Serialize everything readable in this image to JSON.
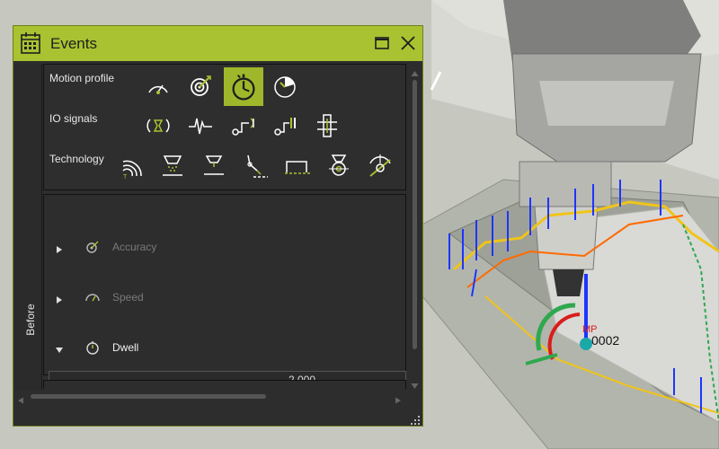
{
  "panel": {
    "title": "Events",
    "side_tab": "Before"
  },
  "categories": [
    {
      "label": "Motion profile",
      "icons": [
        "accuracy-gauge-icon",
        "accuracy-target-icon",
        "dwell-stopwatch-icon",
        "speed-dial-icon"
      ],
      "selected": "dwell-stopwatch-icon"
    },
    {
      "label": "IO signals",
      "icons": [
        "io-pulse-icon",
        "io-waveform-icon",
        "io-output-signal-icon",
        "io-wait-signal-icon",
        "io-clamp-icon"
      ]
    },
    {
      "label": "Technology",
      "icons": [
        "tech-radiation-icon",
        "tech-spray-icon",
        "tech-dispense-icon",
        "tech-robot-arm-icon",
        "tech-path-segment-icon",
        "tech-spindle-icon",
        "tech-sensor-icon"
      ]
    }
  ],
  "events": [
    {
      "label": "Accuracy",
      "expanded": false,
      "enabled": false
    },
    {
      "label": "Speed",
      "expanded": false,
      "enabled": false
    },
    {
      "label": "Dwell",
      "expanded": true,
      "enabled": true,
      "value": "2.000"
    }
  ],
  "viewport": {
    "point_label": "0002"
  },
  "colors": {
    "accent": "#a9c231",
    "panel_bg": "#2d2d2d",
    "highlight": "#9fb72a"
  }
}
